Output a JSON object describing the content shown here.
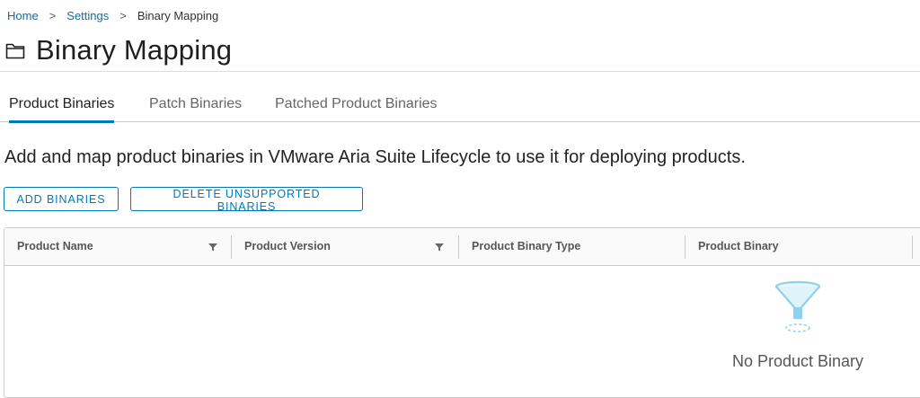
{
  "breadcrumb": {
    "items": [
      "Home",
      "Settings"
    ],
    "current": "Binary Mapping"
  },
  "page": {
    "title": "Binary Mapping",
    "icon": "folder-icon"
  },
  "tabs": [
    {
      "label": "Product Binaries",
      "active": true
    },
    {
      "label": "Patch Binaries",
      "active": false
    },
    {
      "label": "Patched Product Binaries",
      "active": false
    }
  ],
  "description": "Add and map product binaries in VMware Aria Suite Lifecycle to use it for deploying products.",
  "actions": {
    "add_label": "ADD BINARIES",
    "delete_label": "DELETE UNSUPPORTED BINARIES"
  },
  "grid": {
    "columns": [
      {
        "label": "Product Name",
        "filterable": true
      },
      {
        "label": "Product Version",
        "filterable": true
      },
      {
        "label": "Product Binary Type",
        "filterable": false
      },
      {
        "label": "Product Binary",
        "filterable": false
      }
    ],
    "rows": [],
    "empty_text": "No Product Binary"
  },
  "colors": {
    "accent": "#0079b8",
    "link": "#0a6ea8",
    "empty_icon": "#8fd0ec"
  }
}
